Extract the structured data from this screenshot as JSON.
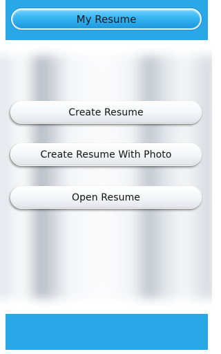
{
  "header": {
    "title": "My Resume"
  },
  "menu": {
    "buttons": [
      {
        "label": "Create Resume"
      },
      {
        "label": "Create Resume With Photo"
      },
      {
        "label": "Open Resume"
      }
    ]
  },
  "colors": {
    "accent": "#29a7e6",
    "title_pill": "#35b4f2",
    "button_face": "#f6f7f9"
  }
}
